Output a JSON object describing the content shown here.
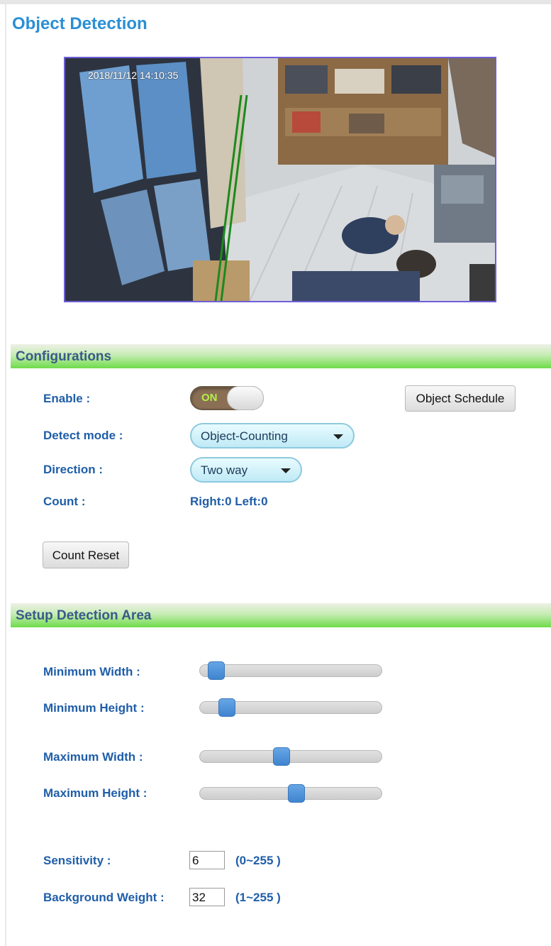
{
  "page": {
    "title": "Object Detection"
  },
  "camera": {
    "timestamp": "2018/11/12 14:10:35"
  },
  "configurations": {
    "header": "Configurations",
    "enable_label": "Enable :",
    "enable_state": "ON",
    "schedule_button": "Object Schedule",
    "detect_mode_label": "Detect mode :",
    "detect_mode_value": "Object-Counting",
    "direction_label": "Direction :",
    "direction_value": "Two way",
    "count_label": "Count :",
    "count_value": "Right:0 Left:0",
    "count_reset_button": "Count Reset"
  },
  "detection_area": {
    "header": "Setup Detection Area",
    "sliders": [
      {
        "label": "Minimum Width :",
        "level": 0.09
      },
      {
        "label": "Minimum Height :",
        "level": 0.15
      },
      {
        "label": "Maximum Width :",
        "level": 0.45
      },
      {
        "label": "Maximum Height :",
        "level": 0.53
      }
    ],
    "sensitivity_label": "Sensitivity :",
    "sensitivity_value": "6",
    "sensitivity_range": "(0~255 )",
    "background_weight_label": "Background Weight :",
    "background_weight_value": "32",
    "background_weight_range": "(1~255 )"
  },
  "colors": {
    "title": "#2a8fd6",
    "label": "#1f5ea8",
    "slider_thumb": "#4a8fd8",
    "camera_border": "#6f5ed6"
  }
}
